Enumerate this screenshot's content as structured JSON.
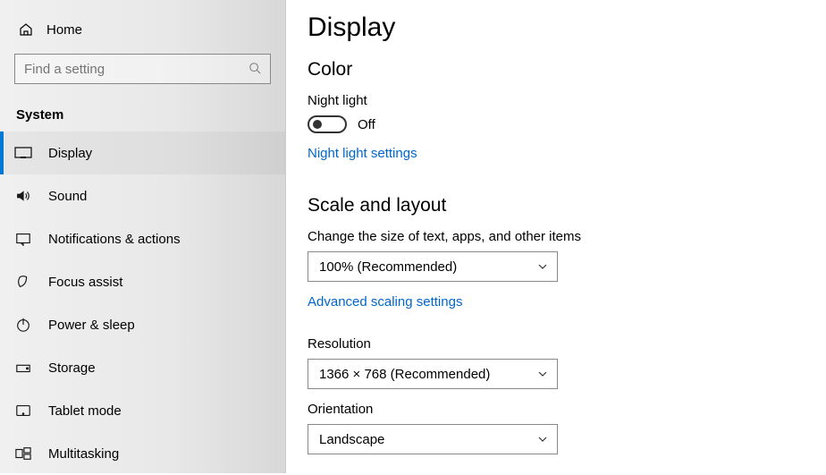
{
  "sidebar": {
    "home_label": "Home",
    "search_placeholder": "Find a setting",
    "section_title": "System",
    "items": [
      {
        "label": "Display"
      },
      {
        "label": "Sound"
      },
      {
        "label": "Notifications & actions"
      },
      {
        "label": "Focus assist"
      },
      {
        "label": "Power & sleep"
      },
      {
        "label": "Storage"
      },
      {
        "label": "Tablet mode"
      },
      {
        "label": "Multitasking"
      }
    ]
  },
  "main": {
    "page_title": "Display",
    "color": {
      "heading": "Color",
      "night_light_label": "Night light",
      "night_light_state": "Off",
      "night_light_link": "Night light settings"
    },
    "scale": {
      "heading": "Scale and layout",
      "scale_label": "Change the size of text, apps, and other items",
      "scale_value": "100% (Recommended)",
      "advanced_link": "Advanced scaling settings",
      "resolution_label": "Resolution",
      "resolution_value": "1366 × 768 (Recommended)",
      "orientation_label": "Orientation",
      "orientation_value": "Landscape"
    }
  }
}
